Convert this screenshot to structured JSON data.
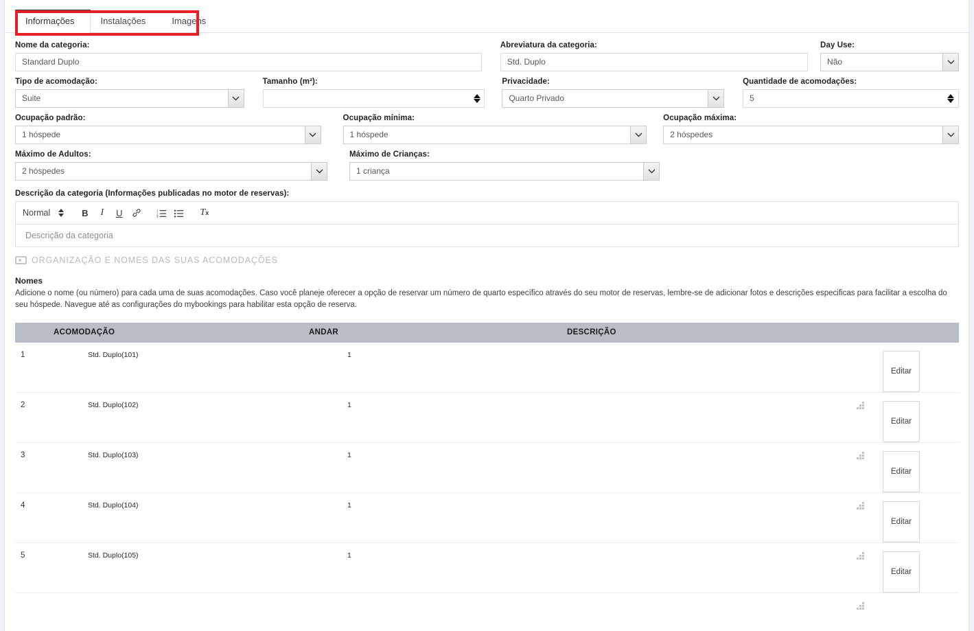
{
  "tabs": [
    {
      "label": "Informações",
      "active": true
    },
    {
      "label": "Instalações",
      "active": false
    },
    {
      "label": "Imagens",
      "active": false
    }
  ],
  "form": {
    "nome_categoria": {
      "label": "Nome da categoria:",
      "value": "Standard Duplo"
    },
    "abreviatura": {
      "label": "Abreviatura da categoria:",
      "value": "Std. Duplo"
    },
    "day_use": {
      "label": "Day Use:",
      "value": "Não"
    },
    "tipo_acomodacao": {
      "label": "Tipo de acomodação:",
      "value": "Suite"
    },
    "tamanho": {
      "label": "Tamanho (m²):",
      "value": ""
    },
    "privacidade": {
      "label": "Privacidade:",
      "value": "Quarto Privado"
    },
    "quantidade_acomodacoes": {
      "label": "Quantidade de acomodações:",
      "value": "5"
    },
    "ocupacao_padrao": {
      "label": "Ocupação padrão:",
      "value": "1 hóspede"
    },
    "ocupacao_minima": {
      "label": "Ocupação mínima:",
      "value": "1 hóspede"
    },
    "ocupacao_maxima": {
      "label": "Ocupação máxima:",
      "value": "2 hóspedes"
    },
    "maximo_adultos": {
      "label": "Máximo de Adultos:",
      "value": "2 hóspedes"
    },
    "maximo_criancas": {
      "label": "Máximo de Crianças:",
      "value": "1 criança"
    },
    "descricao": {
      "label": "Descrição da categoria (Informações publicadas no motor de reservas):",
      "placeholder": "Descrição da categoria"
    }
  },
  "editor_toolbar": {
    "format_label": "Normal",
    "buttons": [
      {
        "name": "bold",
        "glyph": "B"
      },
      {
        "name": "italic",
        "glyph": "I"
      },
      {
        "name": "underline",
        "glyph": "U"
      },
      {
        "name": "link",
        "glyph": "🔗"
      },
      {
        "name": "ordered-list",
        "glyph": "≔"
      },
      {
        "name": "bullet-list",
        "glyph": "☰"
      },
      {
        "name": "clear-format",
        "glyph": "Tx"
      }
    ]
  },
  "section": {
    "title": "ORGANIZAÇÃO E NOMES DAS SUAS ACOMODAÇÕES",
    "icon": "camera-icon"
  },
  "names_block": {
    "heading": "Nomes",
    "paragraph": "Adicione o nome (ou número) para cada uma de suas acomodações. Caso você planeje oferecer a opção de reservar um número de quarto específico através do seu motor de reservas, lembre-se de adicionar fotos e descrições especificas para facilitar a escolha do seu hóspede. Navegue até as configurações do mybookings para habilitar esta opção de reserva."
  },
  "table": {
    "headers": [
      "",
      "ACOMODAÇÃO",
      "ANDAR",
      "DESCRIÇÃO",
      ""
    ],
    "edit_label": "Editar",
    "rows": [
      {
        "index": "1",
        "acomodacao": "Std. Duplo(101)",
        "andar": "1",
        "descricao": ""
      },
      {
        "index": "2",
        "acomodacao": "Std. Duplo(102)",
        "andar": "1",
        "descricao": ""
      },
      {
        "index": "3",
        "acomodacao": "Std. Duplo(103)",
        "andar": "1",
        "descricao": ""
      },
      {
        "index": "4",
        "acomodacao": "Std. Duplo(104)",
        "andar": "1",
        "descricao": ""
      },
      {
        "index": "5",
        "acomodacao": "Std. Duplo(105)",
        "andar": "1",
        "descricao": ""
      }
    ]
  },
  "colors": {
    "annotation": "#e81e25",
    "table_header_bg": "#b9bdc6",
    "active_tab_border": "#2b3a55"
  }
}
